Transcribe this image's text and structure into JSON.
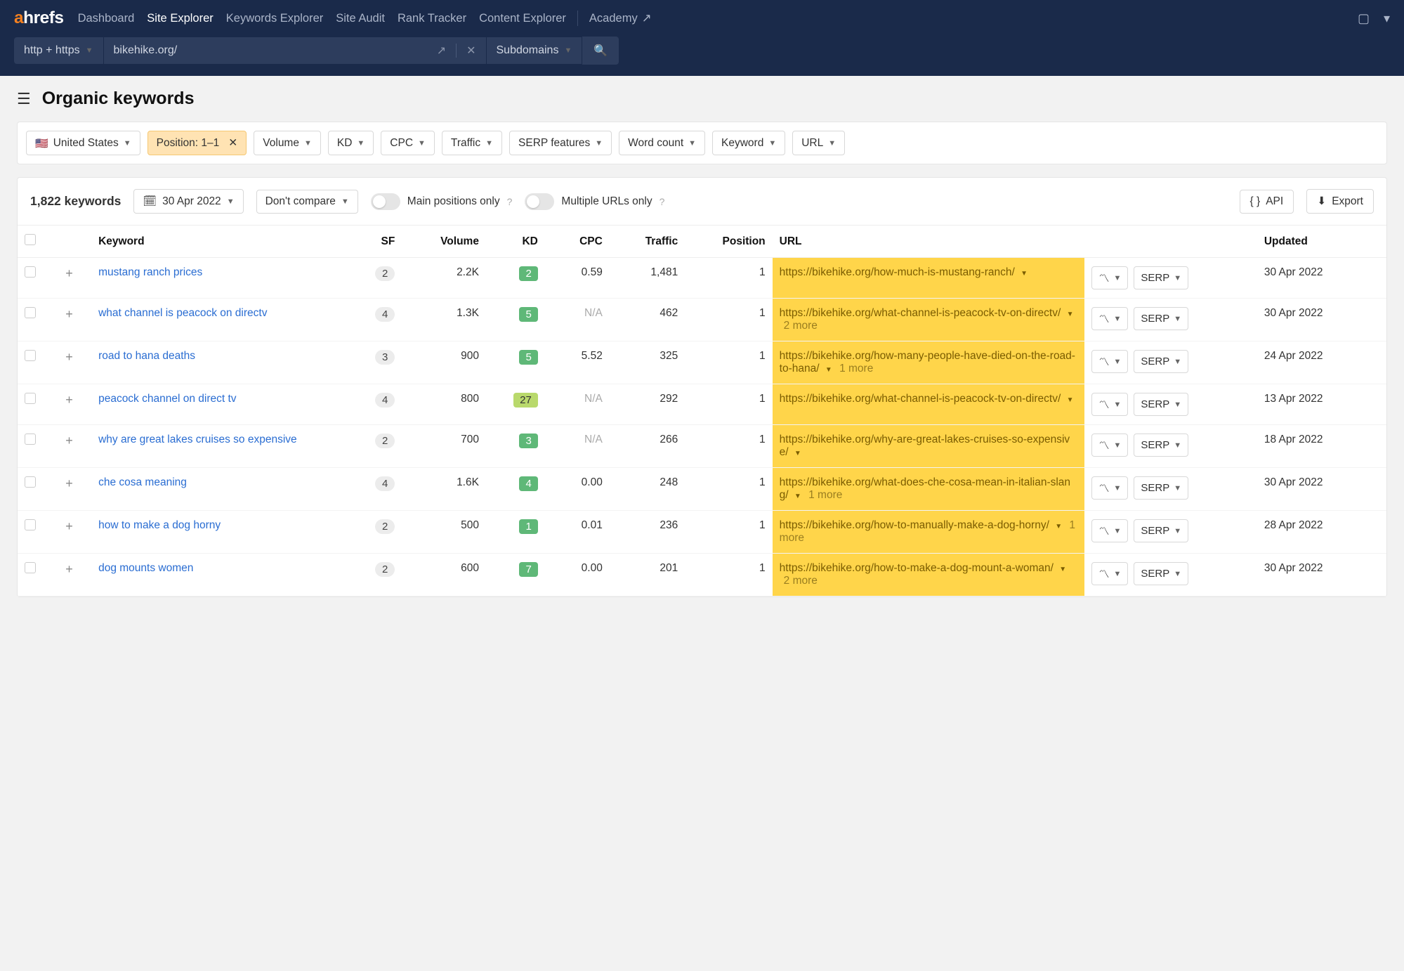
{
  "topnav": {
    "logo_a": "a",
    "logo_rest": "hrefs",
    "items": [
      "Dashboard",
      "Site Explorer",
      "Keywords Explorer",
      "Site Audit",
      "Rank Tracker",
      "Content Explorer"
    ],
    "active_index": 1,
    "academy": "Academy"
  },
  "searchbar": {
    "protocol": "http + https",
    "url": "bikehike.org/",
    "mode": "Subdomains"
  },
  "page": {
    "title": "Organic keywords"
  },
  "filters": {
    "country": "United States",
    "position_label": "Position: 1–1",
    "chips": [
      "Volume",
      "KD",
      "CPC",
      "Traffic",
      "SERP features",
      "Word count",
      "Keyword",
      "URL"
    ]
  },
  "toolbar": {
    "count": "1,822 keywords",
    "date": "30 Apr 2022",
    "compare": "Don't compare",
    "main_positions": "Main positions only",
    "multiple_urls": "Multiple URLs only",
    "api": "API",
    "export": "Export"
  },
  "columns": {
    "keyword": "Keyword",
    "sf": "SF",
    "volume": "Volume",
    "kd": "KD",
    "cpc": "CPC",
    "traffic": "Traffic",
    "position": "Position",
    "url": "URL",
    "updated": "Updated",
    "serp": "SERP"
  },
  "rows": [
    {
      "kw": "mustang ranch prices",
      "sf": "2",
      "vol": "2.2K",
      "kd": "2",
      "kd_cls": "kd-green",
      "cpc": "0.59",
      "traffic": "1,481",
      "pos": "1",
      "url": "https://bikehike.org/how-much-is-mustang-ranch/",
      "more": "",
      "updated": "30 Apr 2022"
    },
    {
      "kw": "what channel is peacock on directv",
      "sf": "4",
      "vol": "1.3K",
      "kd": "5",
      "kd_cls": "kd-green",
      "cpc": "N/A",
      "traffic": "462",
      "pos": "1",
      "url": "https://bikehike.org/what-channel-is-peacock-tv-on-directv/",
      "more": "2 more",
      "updated": "30 Apr 2022"
    },
    {
      "kw": "road to hana deaths",
      "sf": "3",
      "vol": "900",
      "kd": "5",
      "kd_cls": "kd-green",
      "cpc": "5.52",
      "traffic": "325",
      "pos": "1",
      "url": "https://bikehike.org/how-many-people-have-died-on-the-road-to-hana/",
      "more": "1 more",
      "updated": "24 Apr 2022"
    },
    {
      "kw": "peacock channel on direct tv",
      "sf": "4",
      "vol": "800",
      "kd": "27",
      "kd_cls": "kd-lime",
      "cpc": "N/A",
      "traffic": "292",
      "pos": "1",
      "url": "https://bikehike.org/what-channel-is-peacock-tv-on-directv/",
      "more": "",
      "updated": "13 Apr 2022"
    },
    {
      "kw": "why are great lakes cruises so expensive",
      "sf": "2",
      "vol": "700",
      "kd": "3",
      "kd_cls": "kd-green",
      "cpc": "N/A",
      "traffic": "266",
      "pos": "1",
      "url": "https://bikehike.org/why-are-great-lakes-cruises-so-expensive/",
      "more": "",
      "updated": "18 Apr 2022"
    },
    {
      "kw": "che cosa meaning",
      "sf": "4",
      "vol": "1.6K",
      "kd": "4",
      "kd_cls": "kd-green",
      "cpc": "0.00",
      "traffic": "248",
      "pos": "1",
      "url": "https://bikehike.org/what-does-che-cosa-mean-in-italian-slang/",
      "more": "1 more",
      "updated": "30 Apr 2022"
    },
    {
      "kw": "how to make a dog horny",
      "sf": "2",
      "vol": "500",
      "kd": "1",
      "kd_cls": "kd-green",
      "cpc": "0.01",
      "traffic": "236",
      "pos": "1",
      "url": "https://bikehike.org/how-to-manually-make-a-dog-horny/",
      "more": "1 more",
      "updated": "28 Apr 2022"
    },
    {
      "kw": "dog mounts women",
      "sf": "2",
      "vol": "600",
      "kd": "7",
      "kd_cls": "kd-green",
      "cpc": "0.00",
      "traffic": "201",
      "pos": "1",
      "url": "https://bikehike.org/how-to-make-a-dog-mount-a-woman/",
      "more": "2 more",
      "updated": "30 Apr 2022"
    }
  ]
}
